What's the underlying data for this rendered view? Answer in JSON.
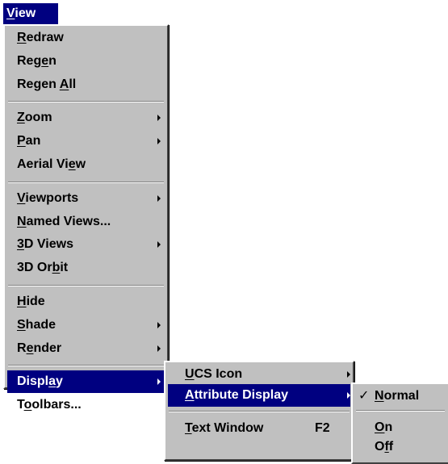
{
  "menubar": {
    "title": "View",
    "mnemonic_index": 0
  },
  "view_menu": {
    "groups": [
      [
        {
          "label": "Redraw",
          "u": 0
        },
        {
          "label": "Regen",
          "u": 3
        },
        {
          "label": "Regen All",
          "u": 6
        }
      ],
      [
        {
          "label": "Zoom",
          "u": 0,
          "submenu": true
        },
        {
          "label": "Pan",
          "u": 0,
          "submenu": true
        },
        {
          "label": "Aerial View",
          "u": 9
        }
      ],
      [
        {
          "label": "Viewports",
          "u": 0,
          "submenu": true
        },
        {
          "label": "Named Views...",
          "u": 0
        },
        {
          "label": "3D Views",
          "u": 0,
          "submenu": true
        },
        {
          "label": "3D Orbit",
          "u": 5
        }
      ],
      [
        {
          "label": "Hide",
          "u": 0
        },
        {
          "label": "Shade",
          "u": 0,
          "submenu": true
        },
        {
          "label": "Render",
          "u": 1,
          "submenu": true
        }
      ],
      [
        {
          "label": "Display",
          "u": 5,
          "submenu": true,
          "selected": true
        },
        {
          "label": "Toolbars...",
          "u": 1
        }
      ]
    ]
  },
  "display_menu": {
    "groups": [
      [
        {
          "label": "UCS Icon",
          "u": 0,
          "submenu": true
        },
        {
          "label": "Attribute Display",
          "u": 0,
          "submenu": true,
          "selected": true
        }
      ],
      [
        {
          "label": "Text Window",
          "u": 0,
          "shortcut": "F2"
        }
      ]
    ]
  },
  "attribute_menu": {
    "groups": [
      [
        {
          "label": "Normal",
          "u": 0,
          "checked": true,
          "check_glyph": "✓"
        }
      ],
      [
        {
          "label": "On",
          "u": 0
        },
        {
          "label": "Off",
          "u": 1
        }
      ]
    ]
  }
}
